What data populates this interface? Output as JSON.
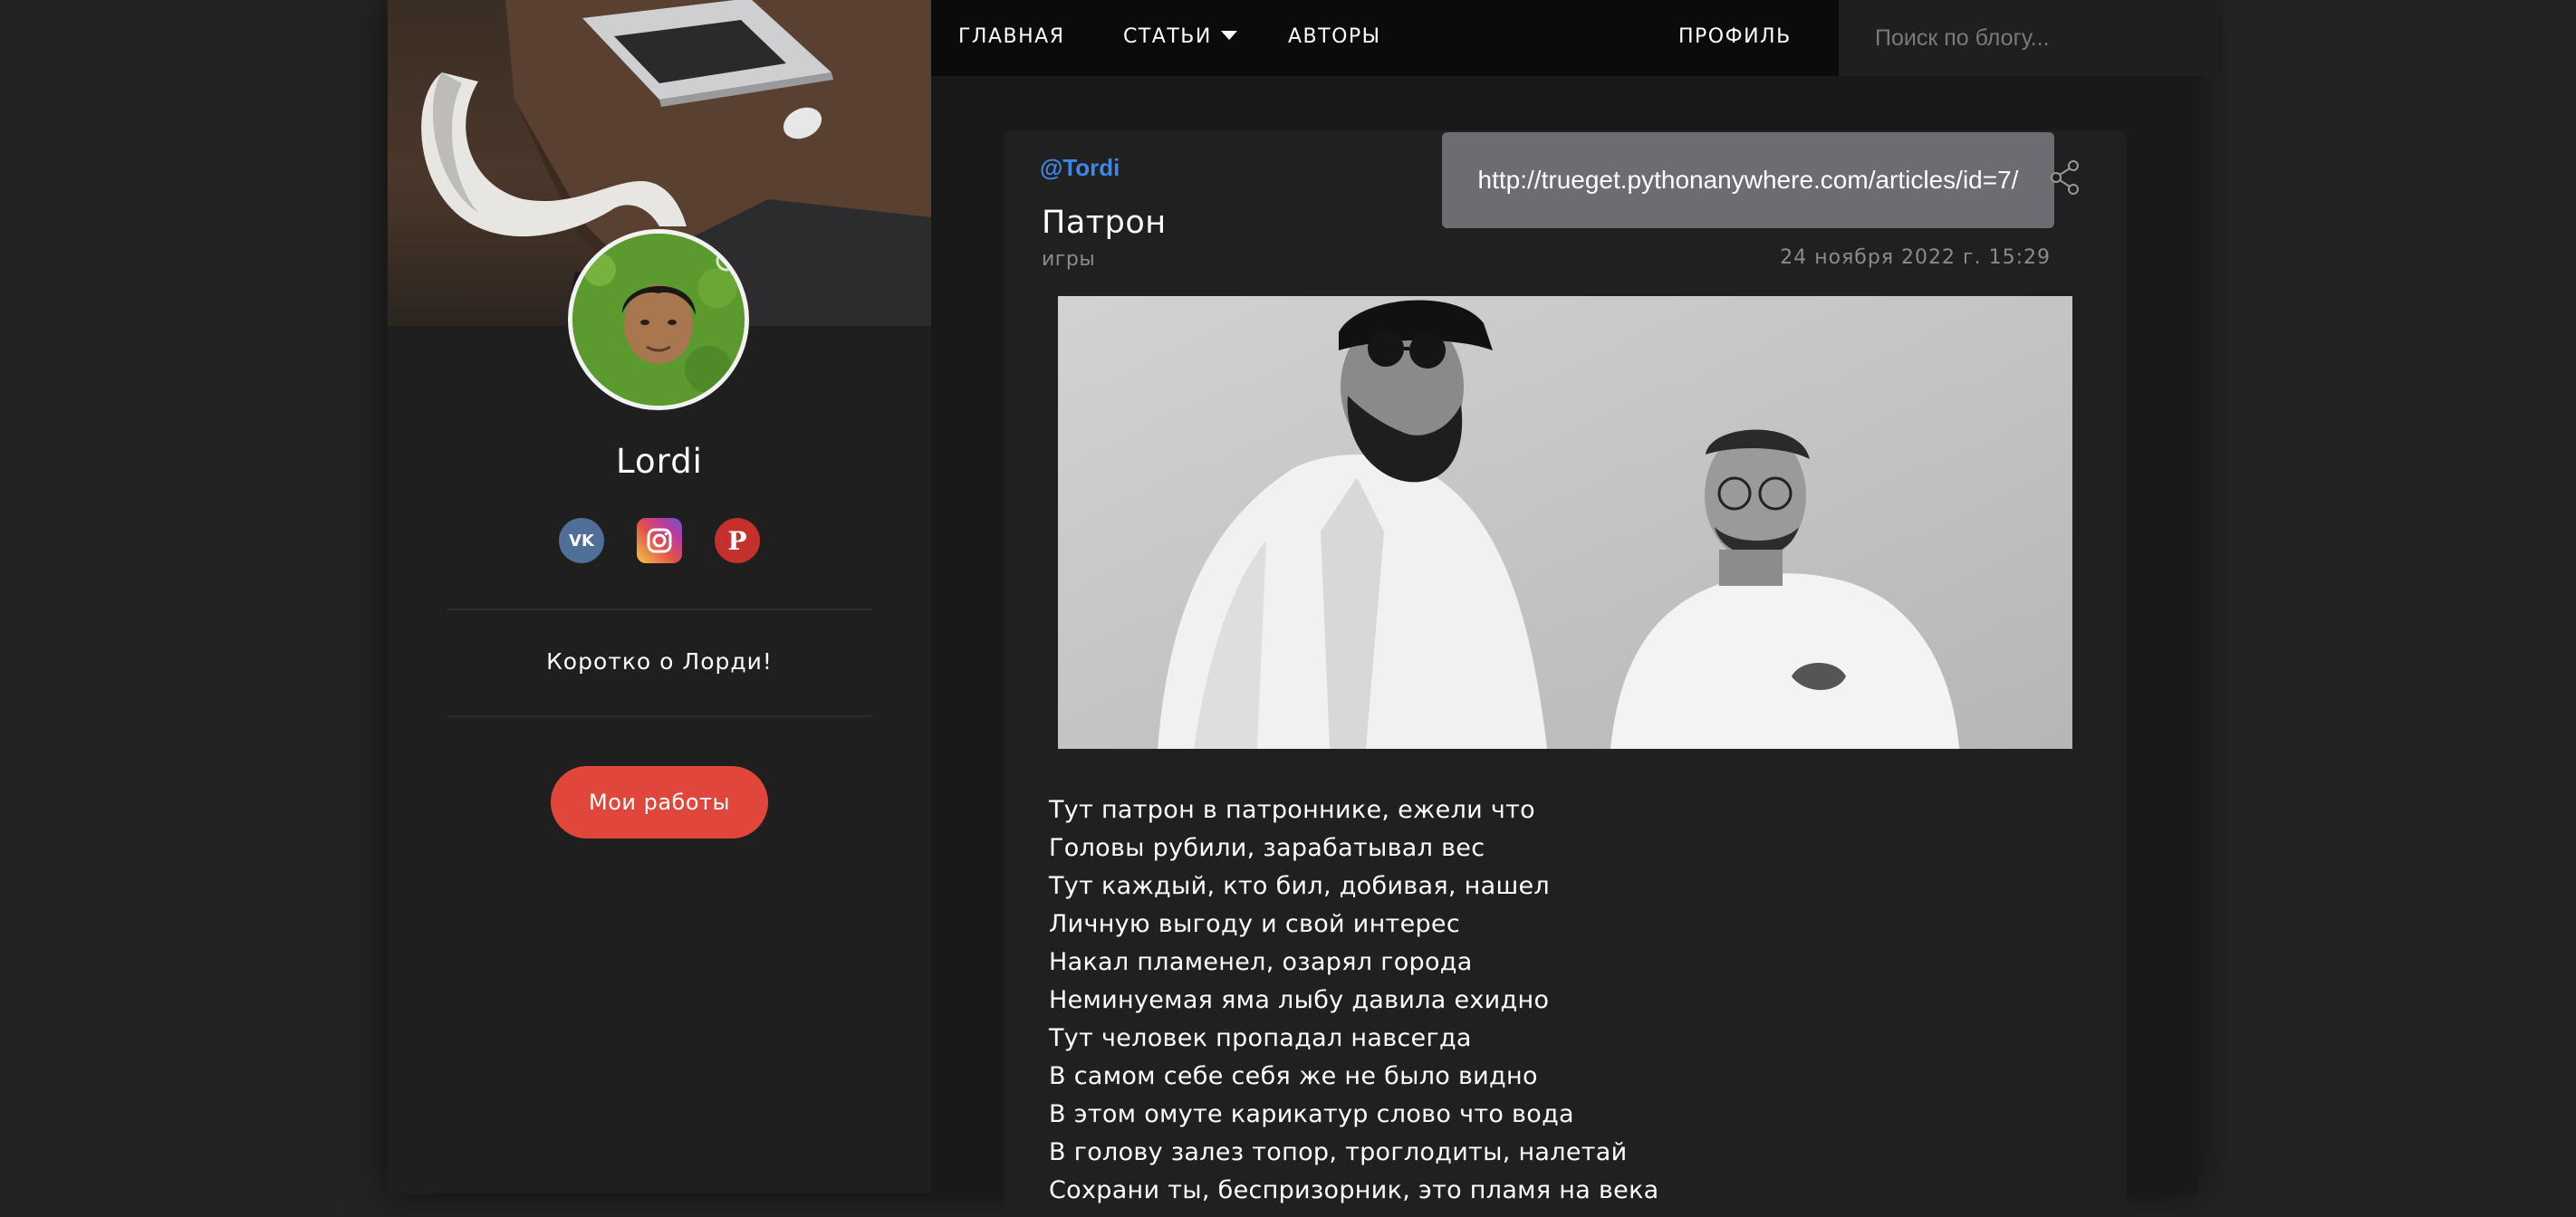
{
  "nav": {
    "home": "ГЛАВНАЯ",
    "articles": "СТАТЬИ",
    "authors": "АВТОРЫ",
    "profile": "ПРОФИЛЬ",
    "search_placeholder": "Поиск по блогу..."
  },
  "sidebar": {
    "author_name": "Lordi",
    "socials": [
      {
        "icon": "vk-icon",
        "label": "VK"
      },
      {
        "icon": "instagram-icon"
      },
      {
        "icon": "pinterest-icon",
        "label": "P"
      }
    ],
    "about": "Коротко о Лорди!",
    "works_button": "Мои работы"
  },
  "article": {
    "author_handle": "@Tordi",
    "title": "Патрон",
    "category": "игры",
    "date": "24 ноября 2022 г. 15:29",
    "share_url": "http://trueget.pythonanywhere.com/articles/id=7/",
    "lines": [
      "Тут патрон в патроннике, ежели что",
      "Головы рубили, зарабатывал вес",
      "Тут каждый, кто бил, добивая, нашел",
      "Личную выгоду и свой интерес",
      "Накал пламенел, озарял города",
      "Неминуемая яма лыбу давила ехидно",
      "Тут человек пропадал навсегда",
      "В самом себе себя же не было видно",
      "В этом омуте карикатур слово что вода",
      "В голову залез топор, троглодиты, налетай",
      "Сохрани ты, беспризорник, это пламя на века"
    ]
  },
  "colors": {
    "accent_button": "#e0463a",
    "link": "#3e86e8",
    "tooltip": "#6e6c72"
  }
}
